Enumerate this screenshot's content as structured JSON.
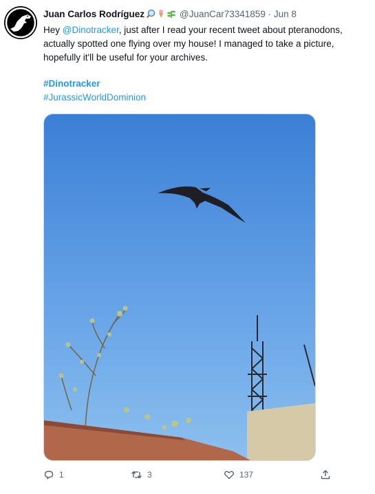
{
  "tweet": {
    "author_name": "Juan Carlos Rodríguez",
    "handle": "@JuanCar73341859",
    "separator": "·",
    "date": "Jun 8",
    "text_before_mention": "Hey ",
    "mention": "@Dinotracker",
    "text_after_mention": ", just after I read your recent tweet about pteranodons, actually spotted one flying over my house! I managed to take a picture, hopefully it'll be useful for your archives.",
    "hashtags": [
      "#Dinotracker",
      "#JurassicWorldDominion"
    ],
    "badge_icons": [
      "magnifier-emoji-icon",
      "ice-cream-emoji-icon",
      "plant-emoji-icon"
    ]
  },
  "actions": {
    "replies": "1",
    "retweets": "3",
    "likes": "137"
  },
  "colors": {
    "link": "#1d9bf0",
    "text": "#0f1419",
    "muted": "#536471",
    "sky_top": "#3b7fd6",
    "sky_bottom": "#8cc0ee"
  }
}
